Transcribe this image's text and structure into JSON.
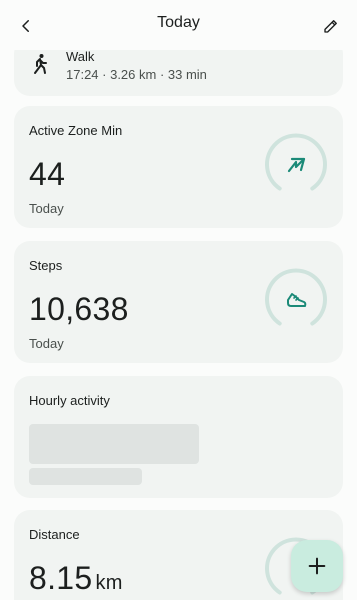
{
  "header": {
    "title": "Today"
  },
  "walk": {
    "title": "Walk",
    "detail": "17:24 · 3.26 km · 33 min"
  },
  "active_zone": {
    "label": "Active Zone Min",
    "value": "44",
    "sub": "Today",
    "icon": "active-zone-arrows-icon"
  },
  "steps": {
    "label": "Steps",
    "value": "10,638",
    "sub": "Today",
    "icon": "shoe-icon"
  },
  "hourly": {
    "label": "Hourly activity"
  },
  "distance": {
    "label": "Distance",
    "value": "8.15",
    "unit": "km"
  },
  "colors": {
    "accent": "#1b8a78",
    "ring_track": "#cfe3dd",
    "card_bg": "#f1f4f2",
    "fab_bg": "#c9ecdf"
  }
}
